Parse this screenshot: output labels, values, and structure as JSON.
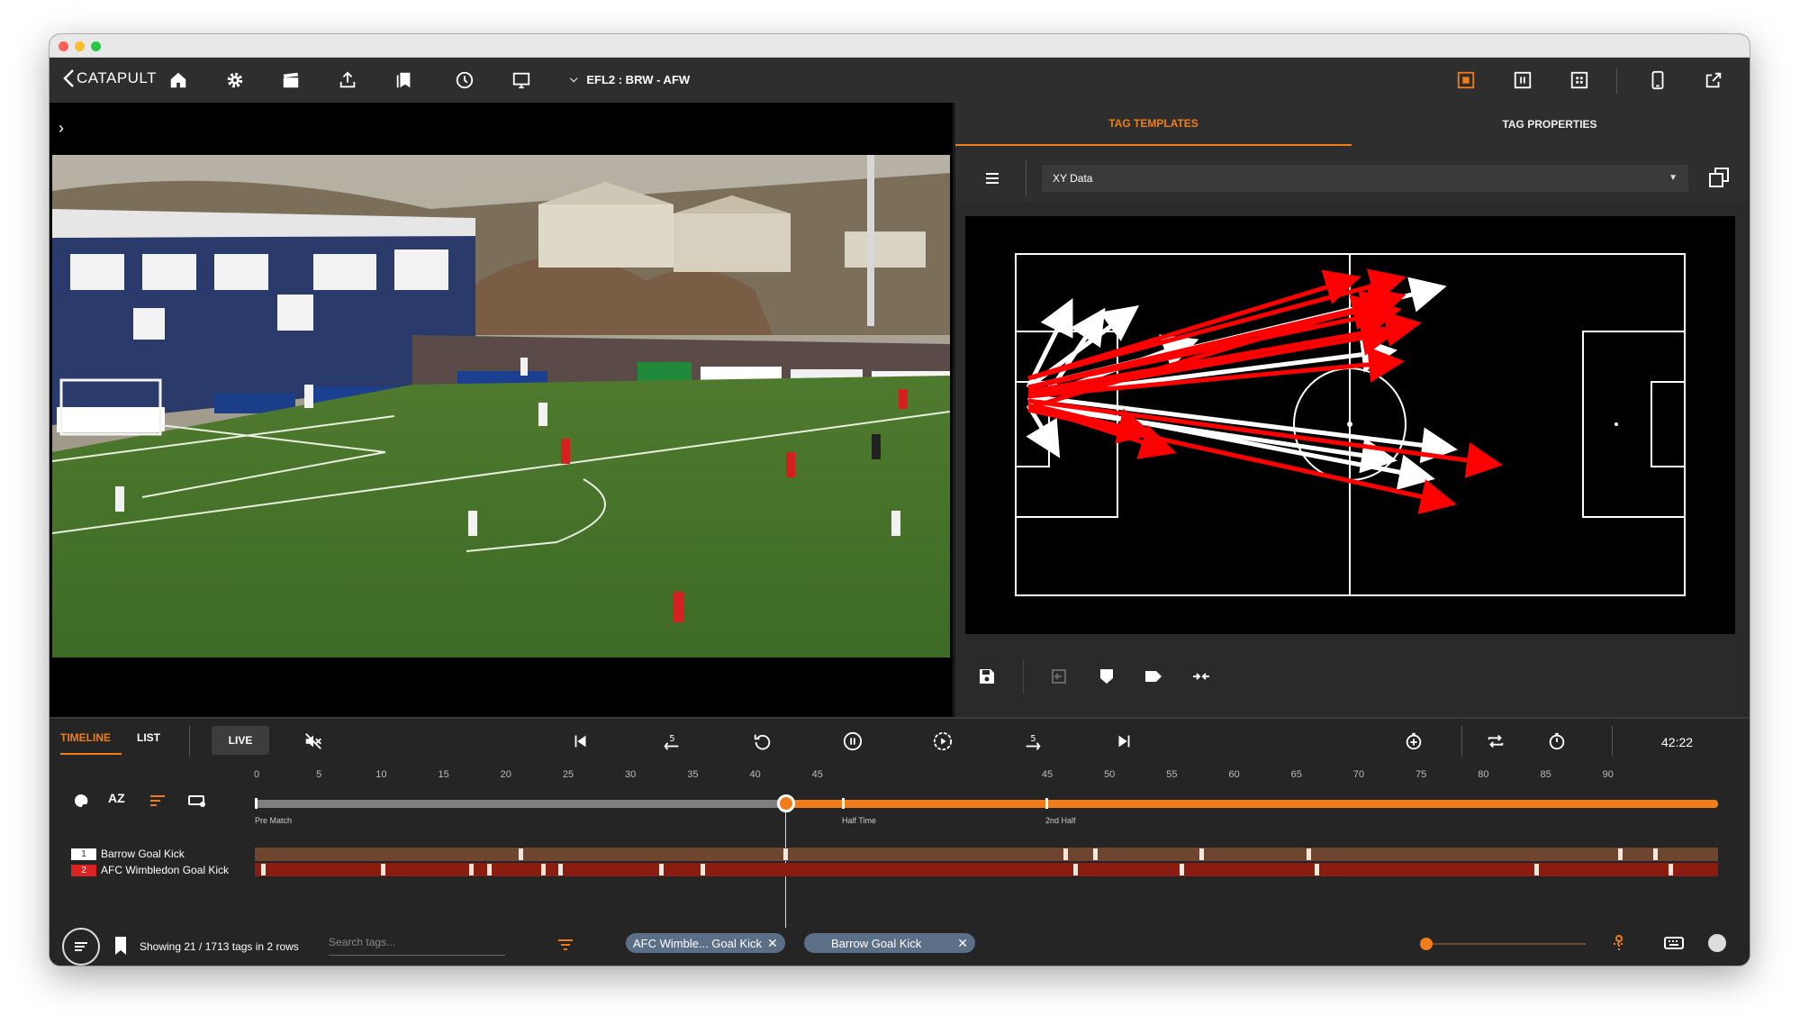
{
  "app": {
    "logo": "CATAPULT",
    "match": "EFL2 : BRW - AFW"
  },
  "panel": {
    "tabs": [
      "TAG TEMPLATES",
      "TAG PROPERTIES"
    ],
    "template_select": "XY Data"
  },
  "timeline": {
    "tabs": [
      "TIMELINE",
      "LIST"
    ],
    "live_label": "LIVE",
    "clock": "42:22",
    "ticks_first_half": [
      "0",
      "5",
      "10",
      "15",
      "20",
      "25",
      "30",
      "35",
      "40",
      "45"
    ],
    "ticks_second_half": [
      "45",
      "50",
      "55",
      "60",
      "65",
      "70",
      "75",
      "80",
      "85",
      "90"
    ],
    "markers": [
      "Pre Match",
      "Half Time",
      "2nd Half"
    ],
    "rows": [
      {
        "num": "1",
        "label": "Barrow Goal Kick"
      },
      {
        "num": "2",
        "label": "AFC Wimbledon Goal Kick"
      }
    ],
    "status": "Showing 21 / 1713 tags in 2 rows",
    "search_placeholder": "Search tags...",
    "chips": [
      "AFC Wimble... Goal Kick",
      "Barrow Goal Kick"
    ]
  },
  "colors": {
    "accent": "#f07d1a",
    "home_tag": "#7a4a2e",
    "away_tag": "#8e1b10",
    "arrow_home": "#ffffff",
    "arrow_away": "#ff0000"
  }
}
